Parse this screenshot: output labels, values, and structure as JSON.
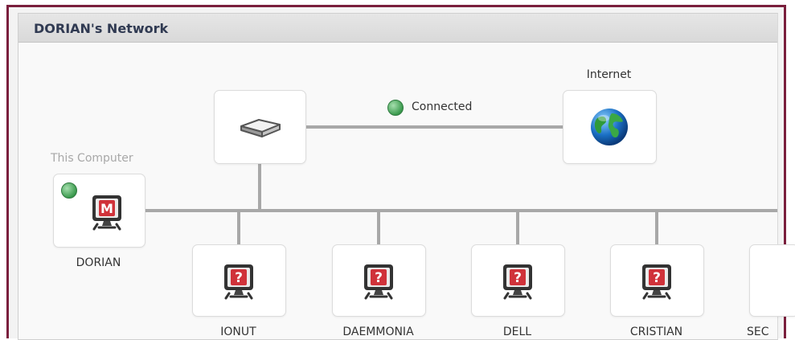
{
  "panel": {
    "title": "DORIAN's Network"
  },
  "status": {
    "connected_label": "Connected",
    "connected_icon": "check-icon"
  },
  "internet": {
    "label": "Internet",
    "icon": "globe-icon"
  },
  "router": {
    "icon": "router-icon"
  },
  "this_computer": {
    "caption": "This Computer",
    "name": "DORIAN",
    "icon": "mcafee-monitor-icon",
    "status_icon": "check-icon"
  },
  "devices": [
    {
      "name": "IONUT",
      "icon": "unknown-computer-icon"
    },
    {
      "name": "DAEMMONIA",
      "icon": "unknown-computer-icon"
    },
    {
      "name": "DELL",
      "icon": "unknown-computer-icon"
    },
    {
      "name": "CRISTIAN",
      "icon": "unknown-computer-icon"
    },
    {
      "name": "SEC",
      "icon": "unknown-computer-icon"
    }
  ],
  "colors": {
    "frame_border": "#7a1f3d",
    "title_text": "#303a52",
    "line": "#a8a8a8",
    "check_green": "#3b9a4e",
    "monitor_red": "#d0323a"
  }
}
